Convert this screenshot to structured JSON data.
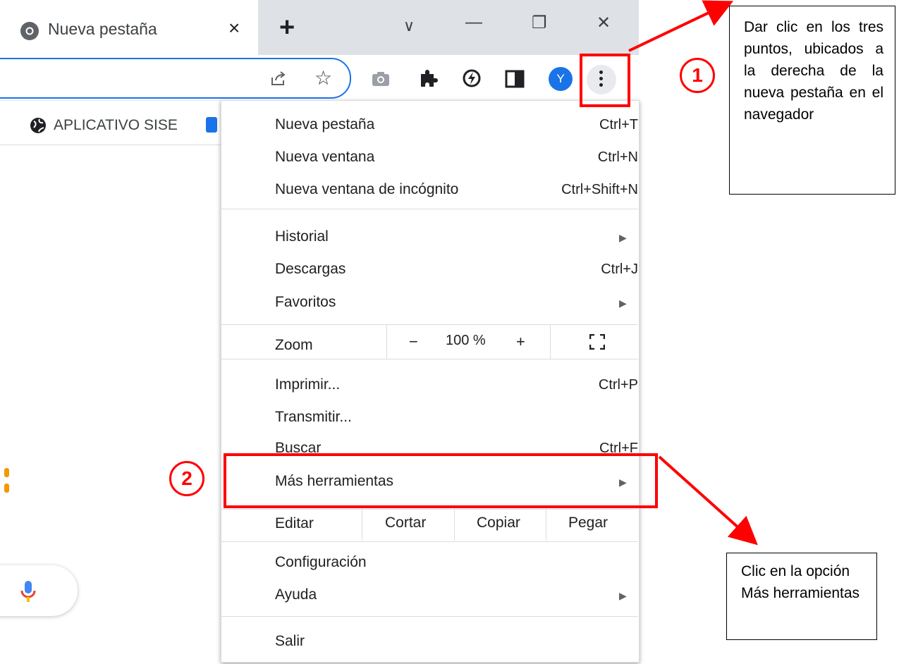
{
  "tab": {
    "title": "Nueva pestaña",
    "close": "×",
    "new_tab": "+"
  },
  "window_controls": {
    "tab_search": "∨",
    "minimize": "—",
    "restore": "❐",
    "close": "✕"
  },
  "toolbar": {
    "avatar_letter": "Y"
  },
  "bookmarks": {
    "item1": "APLICATIVO SISE"
  },
  "menu": {
    "new_tab": {
      "label": "Nueva pestaña",
      "shortcut": "Ctrl+T"
    },
    "new_window": {
      "label": "Nueva ventana",
      "shortcut": "Ctrl+N"
    },
    "incognito": {
      "label": "Nueva ventana de incógnito",
      "shortcut": "Ctrl+Shift+N"
    },
    "history": {
      "label": "Historial"
    },
    "downloads": {
      "label": "Descargas",
      "shortcut": "Ctrl+J"
    },
    "bookmarks": {
      "label": "Favoritos"
    },
    "zoom": {
      "label": "Zoom",
      "minus": "−",
      "value": "100 %",
      "plus": "+"
    },
    "print": {
      "label": "Imprimir...",
      "shortcut": "Ctrl+P"
    },
    "cast": {
      "label": "Transmitir..."
    },
    "find": {
      "label": "Buscar",
      "shortcut": "Ctrl+F"
    },
    "more_tools": {
      "label": "Más herramientas"
    },
    "edit": {
      "label": "Editar",
      "cut": "Cortar",
      "copy": "Copiar",
      "paste": "Pegar"
    },
    "settings": {
      "label": "Configuración"
    },
    "help": {
      "label": "Ayuda"
    },
    "exit": {
      "label": "Salir"
    }
  },
  "annotations": {
    "step1_number": "1",
    "step2_number": "2",
    "callout1": "Dar clic en los tres puntos, ubicados a la derecha de la nueva pestaña en el navegador",
    "callout2": "Clic en la opción Más herramientas",
    "highlight_color": "#ff0000"
  }
}
